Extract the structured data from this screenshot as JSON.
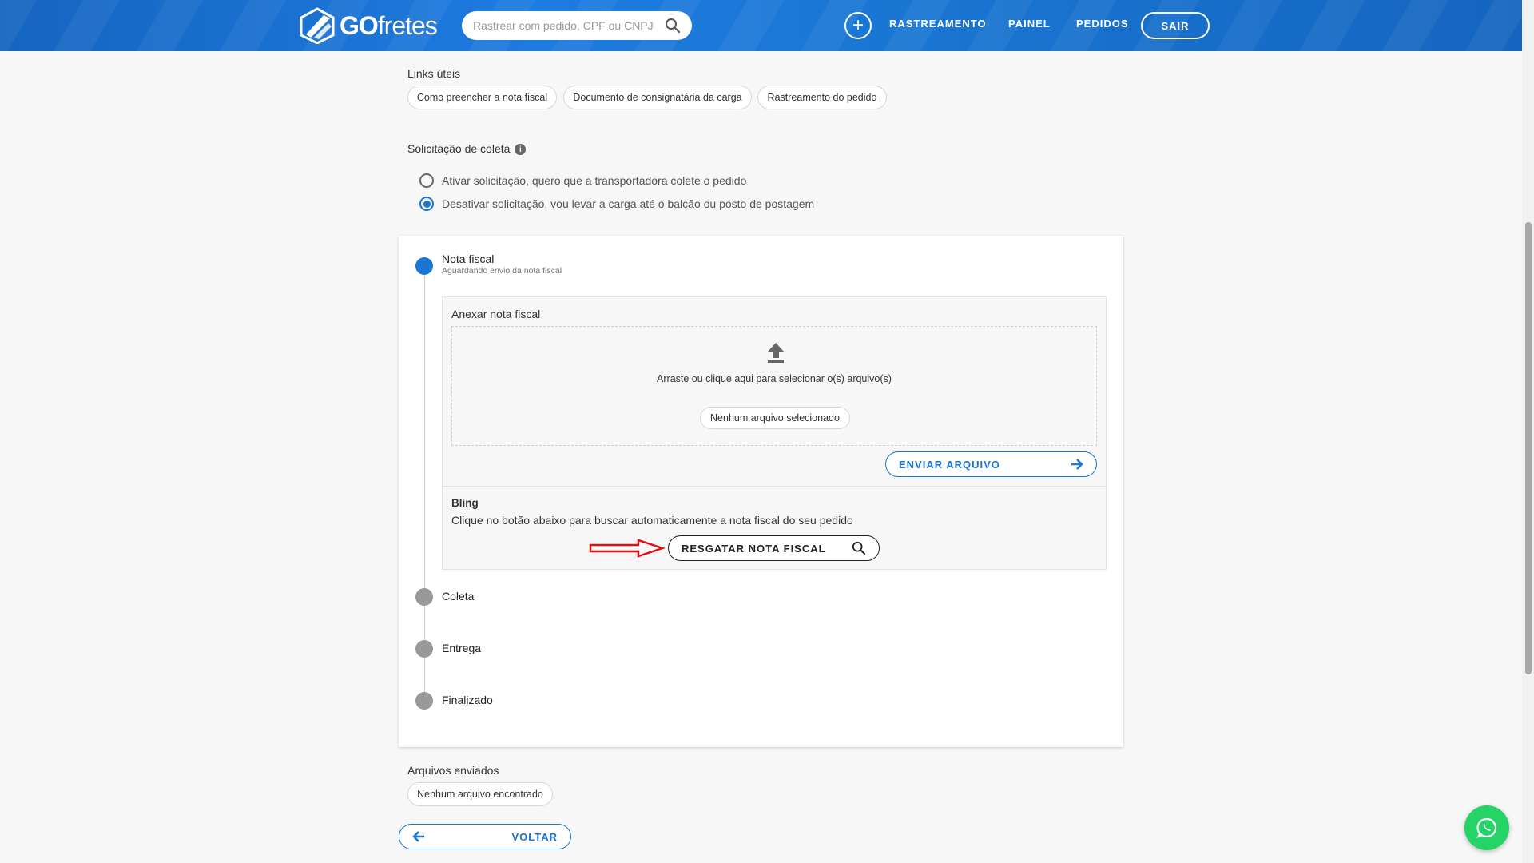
{
  "header": {
    "logo": {
      "text_bold": "GO",
      "text_light": "fretes"
    },
    "search": {
      "placeholder": "Rastrear com pedido, CPF ou CNPJ",
      "icon": "search-icon"
    },
    "add_icon": "plus-circle-icon",
    "nav": [
      {
        "label": "RASTREAMENTO"
      },
      {
        "label": "PAINEL"
      },
      {
        "label": "PEDIDOS"
      }
    ],
    "logout_label": "SAIR",
    "colors": {
      "primary": "#1976d2",
      "header": "#1565c0"
    }
  },
  "links_uteis": {
    "title": "Links úteis",
    "items": [
      "Como preencher a nota fiscal",
      "Documento de consignatária da carga",
      "Rastreamento do pedido"
    ]
  },
  "solicitacao": {
    "title": "Solicitação de coleta",
    "info_icon": "i",
    "options": [
      {
        "label": "Ativar solicitação, quero que a transportadora colete o pedido",
        "checked": false
      },
      {
        "label": "Desativar solicitação, vou levar a carga até o balcão ou posto de postagem",
        "checked": true
      }
    ]
  },
  "steps": [
    {
      "title": "Nota fiscal",
      "subtitle": "Aguardando envio da nota fiscal",
      "active": true
    },
    {
      "title": "Coleta",
      "active": false
    },
    {
      "title": "Entrega",
      "active": false
    },
    {
      "title": "Finalizado",
      "active": false
    }
  ],
  "anexar": {
    "title": "Anexar nota fiscal",
    "upload_icon": "upload-icon",
    "drop_text": "Arraste ou clique aqui para selecionar o(s) arquivo(s)",
    "no_file": "Nenhum arquivo selecionado",
    "send_label": "ENVIAR ARQUIVO"
  },
  "bling": {
    "title": "Bling",
    "description": "Clique no botão abaixo para buscar automaticamente a nota fiscal do seu pedido",
    "button_label": "RESGATAR NOTA FISCAL"
  },
  "arquivos": {
    "title": "Arquivos enviados",
    "empty": "Nenhum arquivo encontrado"
  },
  "back_label": "VOLTAR"
}
